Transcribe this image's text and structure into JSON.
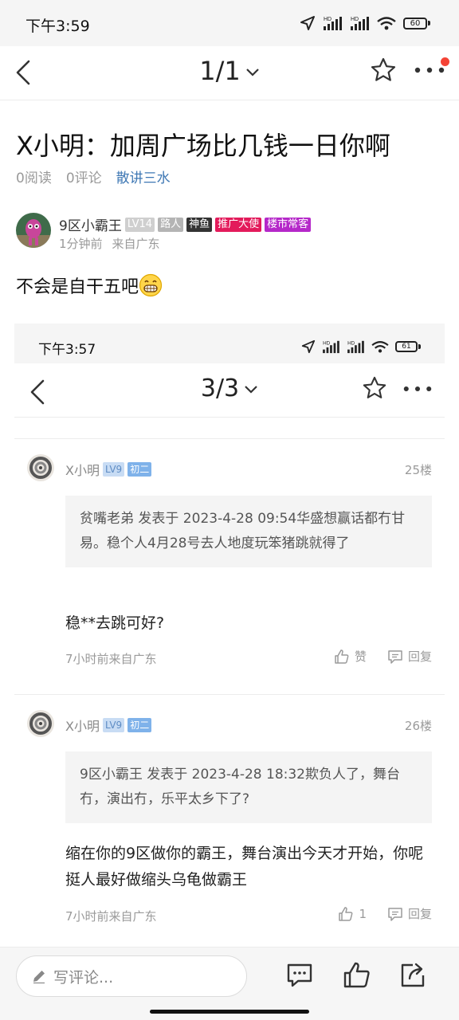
{
  "status_bar": {
    "time": "下午3:59",
    "hd1": "HD",
    "hd2": "HD",
    "battery": "60"
  },
  "nav": {
    "page_indicator": "1/1"
  },
  "post": {
    "title": "X小明：加周广场比几钱一日你啊",
    "reads": "0阅读",
    "comments": "0评论",
    "category": "散讲三水",
    "content": "不会是自干五吧"
  },
  "author": {
    "name": "9区小霸王",
    "badges": [
      "LV14",
      "路人",
      "神鱼",
      "推广大使",
      "楼市常客"
    ],
    "time": "1分钟前",
    "location": "来自广东"
  },
  "embedded_screenshot": {
    "status_bar": {
      "time": "下午3:57",
      "hd1": "HD",
      "hd2": "HD",
      "battery": "61"
    },
    "page_indicator": "3/3",
    "comments": [
      {
        "user": "X小明",
        "level": "LV9",
        "rank": "初二",
        "floor": "25楼",
        "quote": "贫嘴老弟 发表于 2023-4-28 09:54华盛想赢话都冇甘易。稳个人4月28号去人地度玩笨猪跳就得了",
        "text": "稳**去跳可好?",
        "time": "7小时前来自广东",
        "like_label": "赞",
        "reply_label": "回复"
      },
      {
        "user": "X小明",
        "level": "LV9",
        "rank": "初二",
        "floor": "26楼",
        "quote": "9区小霸王 发表于 2023-4-28 18:32欺负人了，舞台冇，演出冇，乐平太乡下了?",
        "text": "缩在你的9区做你的霸王，舞台演出今天才开始，你呢挺人最好做缩头乌龟做霸王",
        "time": "7小时前来自广东",
        "like_count": "1",
        "reply_label": "回复"
      }
    ]
  },
  "bottom_bar": {
    "comment_placeholder": "写评论..."
  },
  "colors": {
    "accent_link": "#3f78b4",
    "red_dot": "#f44336",
    "badge_promo": "#e31b5b",
    "badge_loushi": "#b528c9"
  }
}
